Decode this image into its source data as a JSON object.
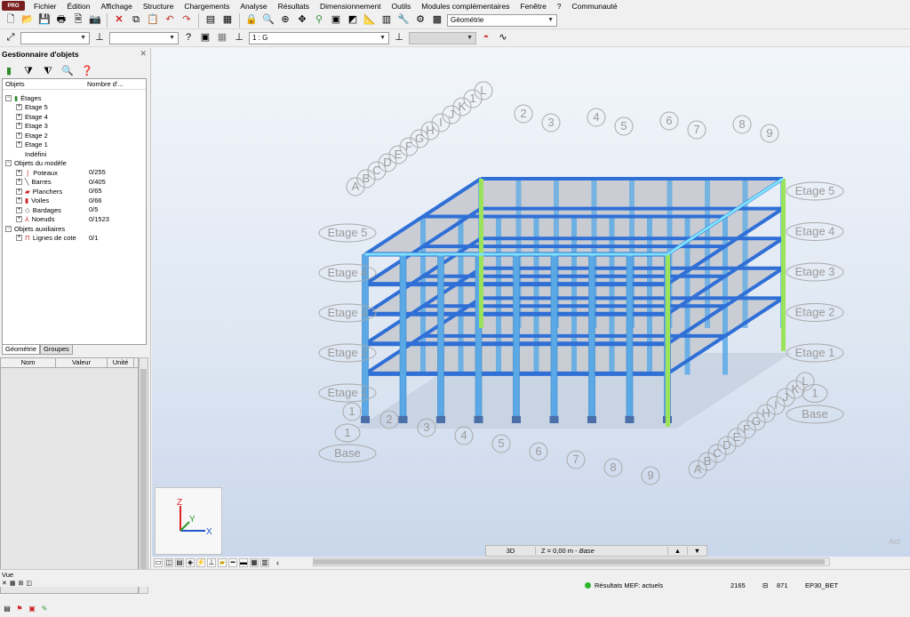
{
  "menubar": {
    "badge": "PRO",
    "items": [
      "Fichier",
      "Édition",
      "Affichage",
      "Structure",
      "Chargements",
      "Analyse",
      "Résultats",
      "Dimensionnement",
      "Outils",
      "Modules complémentaires",
      "Fenêtre",
      "?",
      "Communauté"
    ]
  },
  "toolbar1": {
    "layout_select": "Géométrie"
  },
  "toolbar2": {
    "combo1": "",
    "combo2": "",
    "combo3": "1 : G",
    "combo4": ""
  },
  "left_panel": {
    "title": "Gestionnaire d'objets",
    "col_objects": "Objets",
    "col_count": "Nombre d'...",
    "tree": [
      {
        "label": "Étages",
        "count": ""
      },
      {
        "label": "Etage 5",
        "count": ""
      },
      {
        "label": "Etage 4",
        "count": ""
      },
      {
        "label": "Etage 3",
        "count": ""
      },
      {
        "label": "Etage 2",
        "count": ""
      },
      {
        "label": "Etage 1",
        "count": ""
      },
      {
        "label": "Indéfini",
        "count": ""
      },
      {
        "label": "Objets du modèle",
        "count": ""
      },
      {
        "label": "Poteaux",
        "count": "0/255"
      },
      {
        "label": "Barres",
        "count": "0/405"
      },
      {
        "label": "Planchers",
        "count": "0/65"
      },
      {
        "label": "Voiles",
        "count": "0/66"
      },
      {
        "label": "Bardages",
        "count": "0/5"
      },
      {
        "label": "Noeuds",
        "count": "0/1523"
      },
      {
        "label": "Objets auxiliaires",
        "count": ""
      },
      {
        "label": "Lignes de cote",
        "count": "0/1"
      }
    ],
    "tab_geometry": "Géométrie",
    "tab_groups": "Groupes",
    "props_col_name": "Nom",
    "props_col_value": "Valeur",
    "props_col_unit": "Unité"
  },
  "viewport": {
    "floor_labels_right": [
      "Etage 5",
      "Etage 4",
      "Etage 3",
      "Etage 2",
      "Etage 1",
      "1",
      "Base"
    ],
    "floor_labels_left": [
      "Etage 5",
      "Etage 4",
      "Etage 3",
      "Etage 2",
      "Etage 1",
      "1",
      "Base"
    ],
    "grid_top_numbers": [
      "2",
      "3",
      "4",
      "5",
      "6",
      "7",
      "8",
      "9"
    ],
    "grid_top_letters": [
      "L",
      "1",
      "K",
      "J",
      "I",
      "H",
      "G",
      "F",
      "E",
      "D",
      "C",
      "B",
      "A"
    ],
    "grid_bottom_numbers": [
      "1",
      "2",
      "3",
      "4",
      "5",
      "6",
      "7",
      "8",
      "9"
    ],
    "grid_bottom_letters": [
      "A",
      "B",
      "C",
      "D",
      "E",
      "F",
      "G",
      "H",
      "I",
      "J",
      "K",
      "L"
    ],
    "axis_z": "Z",
    "axis_y": "Y",
    "axis_x": "X"
  },
  "view_status": {
    "mode": "3D",
    "level_prefix": "Z = 0,00 m - ",
    "level_name": "Base"
  },
  "watermark": "Act",
  "statusbar": {
    "view_label": "Vue",
    "message": "Résultats MEF: actuels",
    "val1": "2165",
    "val2": "871",
    "code": "EP30_BET"
  },
  "colors": {
    "column": "#5aa9e6",
    "beam": "#2f6fd6",
    "edge_green": "#9be35a",
    "slab": "#c8ccd2"
  }
}
